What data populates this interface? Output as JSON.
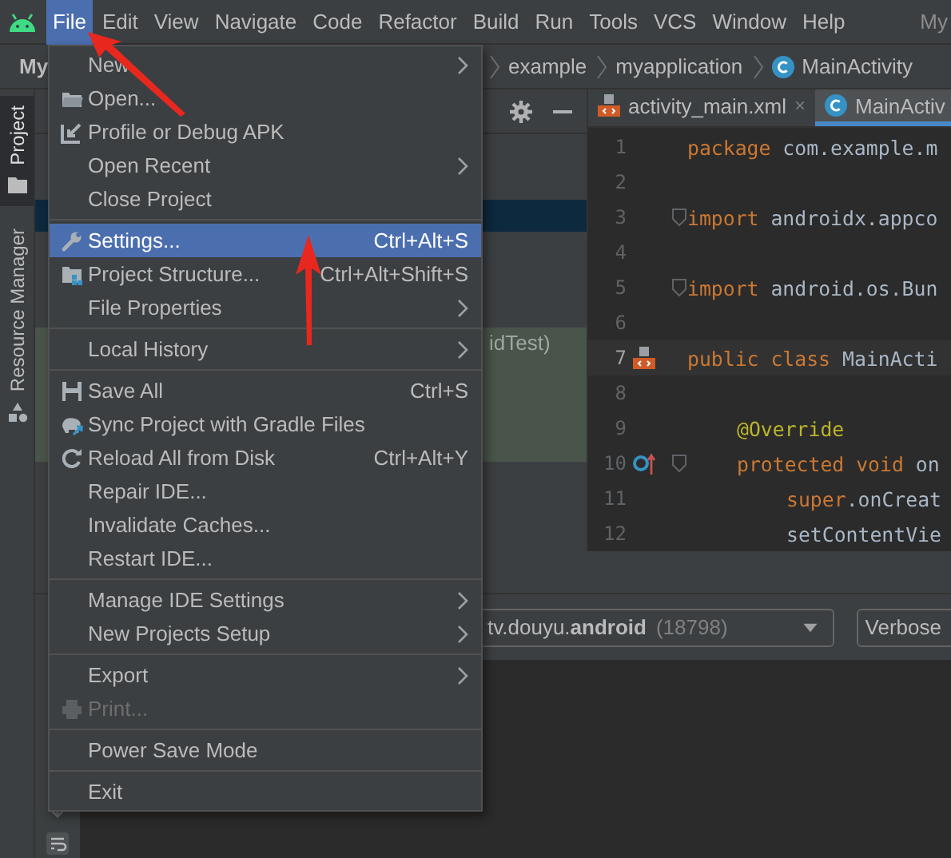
{
  "menu_bar": {
    "items": [
      {
        "label": "File",
        "selected": true
      },
      {
        "label": "Edit",
        "selected": false
      },
      {
        "label": "View",
        "selected": false
      },
      {
        "label": "Navigate",
        "selected": false
      },
      {
        "label": "Code",
        "selected": false
      },
      {
        "label": "Refactor",
        "selected": false
      },
      {
        "label": "Build",
        "selected": false
      },
      {
        "label": "Run",
        "selected": false
      },
      {
        "label": "Tools",
        "selected": false
      },
      {
        "label": "VCS",
        "selected": false
      },
      {
        "label": "Window",
        "selected": false
      },
      {
        "label": "Help",
        "selected": false
      }
    ],
    "window_title": "My"
  },
  "nav_bar": {
    "project": "My",
    "breadcrumbs": [
      {
        "label": "example",
        "kind": "package"
      },
      {
        "label": "myapplication",
        "kind": "package"
      },
      {
        "label": "MainActivity",
        "kind": "class"
      }
    ]
  },
  "tool_strip": {
    "tabs": [
      {
        "label": "Project",
        "selected": true
      },
      {
        "label": "Resource Manager",
        "selected": false
      }
    ]
  },
  "project_panel": {
    "visible_row_text": "idTest)"
  },
  "editor": {
    "tabs": [
      {
        "label": "activity_main.xml",
        "kind": "layout",
        "selected": false,
        "close": "×"
      },
      {
        "label": "MainActiv",
        "kind": "class",
        "selected": true
      }
    ],
    "lines": [
      {
        "number": "1",
        "current": false,
        "tokens": [
          {
            "text": "package",
            "kind": "keyword"
          },
          {
            "text": " com.example.m",
            "kind": "plain"
          }
        ]
      },
      {
        "number": "2",
        "current": false
      },
      {
        "number": "3",
        "current": false,
        "fold": true,
        "tokens": [
          {
            "text": "import",
            "kind": "keyword"
          },
          {
            "text": " androidx.appco",
            "kind": "plain"
          }
        ]
      },
      {
        "number": "4",
        "current": false
      },
      {
        "number": "5",
        "current": false,
        "fold": true,
        "tokens": [
          {
            "text": "import",
            "kind": "keyword"
          },
          {
            "text": " android.os.Bun",
            "kind": "plain"
          }
        ]
      },
      {
        "number": "6",
        "current": false
      },
      {
        "number": "7",
        "current": true,
        "related_layout": true,
        "tokens": [
          {
            "text": "public class",
            "kind": "keyword"
          },
          {
            "text": " MainActi",
            "kind": "plain"
          }
        ],
        "children": [
          {
            "number": "8",
            "current": false
          },
          {
            "number": "9",
            "current": false,
            "tokens": [
              {
                "text": "@Override",
                "kind": "annotation"
              }
            ]
          },
          {
            "number": "10",
            "current": false,
            "fold": true,
            "overrides_method": true,
            "tokens": [
              {
                "text": "protected void ",
                "kind": "keyword"
              },
              {
                "text": "on",
                "kind": "plain"
              }
            ],
            "children": [
              {
                "number": "11",
                "current": false,
                "tokens": [
                  {
                    "text": "super",
                    "kind": "keyword"
                  },
                  {
                    "text": ".onCreat",
                    "kind": "plain"
                  }
                ]
              },
              {
                "number": "12",
                "current": false,
                "tokens": [
                  {
                    "text": "setContentVie",
                    "kind": "plain"
                  }
                ]
              }
            ]
          }
        ]
      }
    ]
  },
  "file_menu": {
    "items": [
      {
        "kind": "item",
        "label": "New",
        "submenu": true,
        "disabled": false,
        "selected": false
      },
      {
        "kind": "item",
        "label": "Open...",
        "disabled": false,
        "selected": false
      },
      {
        "kind": "item",
        "label": "Profile or Debug APK",
        "disabled": false,
        "selected": false
      },
      {
        "kind": "item",
        "label": "Open Recent",
        "submenu": true,
        "disabled": false,
        "selected": false
      },
      {
        "kind": "item",
        "label": "Close Project",
        "disabled": false,
        "selected": false
      },
      {
        "kind": "separator"
      },
      {
        "kind": "item",
        "label": "Settings...",
        "shortcut": "Ctrl+Alt+S",
        "disabled": false,
        "selected": true
      },
      {
        "kind": "item",
        "label": "Project Structure...",
        "shortcut": "Ctrl+Alt+Shift+S",
        "disabled": false,
        "selected": false
      },
      {
        "kind": "item",
        "label": "File Properties",
        "submenu": true,
        "disabled": false,
        "selected": false
      },
      {
        "kind": "separator"
      },
      {
        "kind": "item",
        "label": "Local History",
        "submenu": true,
        "disabled": false,
        "selected": false
      },
      {
        "kind": "separator"
      },
      {
        "kind": "item",
        "label": "Save All",
        "shortcut": "Ctrl+S",
        "disabled": false,
        "selected": false
      },
      {
        "kind": "item",
        "label": "Sync Project with Gradle Files",
        "disabled": false,
        "selected": false
      },
      {
        "kind": "item",
        "label": "Reload All from Disk",
        "shortcut": "Ctrl+Alt+Y",
        "disabled": false,
        "selected": false
      },
      {
        "kind": "item",
        "label": "Repair IDE...",
        "disabled": false,
        "selected": false
      },
      {
        "kind": "item",
        "label": "Invalidate Caches...",
        "disabled": false,
        "selected": false
      },
      {
        "kind": "item",
        "label": "Restart IDE...",
        "disabled": false,
        "selected": false
      },
      {
        "kind": "separator"
      },
      {
        "kind": "item",
        "label": "Manage IDE Settings",
        "submenu": true,
        "disabled": false,
        "selected": false
      },
      {
        "kind": "item",
        "label": "New Projects Setup",
        "submenu": true,
        "disabled": false,
        "selected": false
      },
      {
        "kind": "separator"
      },
      {
        "kind": "item",
        "label": "Export",
        "submenu": true,
        "disabled": false,
        "selected": false
      },
      {
        "kind": "item",
        "label": "Print...",
        "disabled": true,
        "selected": false
      },
      {
        "kind": "separator"
      },
      {
        "kind": "item",
        "label": "Power Save Mode",
        "disabled": false,
        "selected": false
      },
      {
        "kind": "separator"
      },
      {
        "kind": "item",
        "label": "Exit",
        "disabled": false,
        "selected": false
      }
    ]
  },
  "logcat": {
    "process": {
      "package": "tv.douyu.**android**",
      "pid": "(18798)"
    },
    "level": "Verbose"
  }
}
